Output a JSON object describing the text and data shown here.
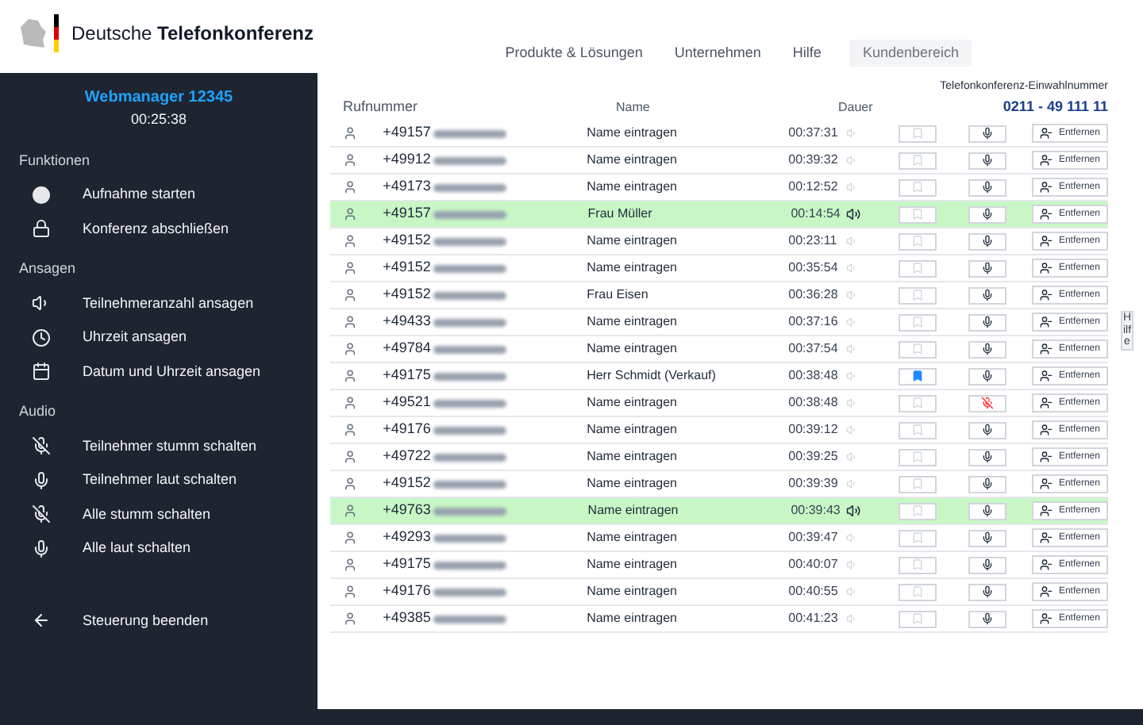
{
  "header": {
    "brand_light": "Deutsche",
    "brand_bold": "Telefonkonferenz",
    "nav": [
      {
        "label": "Produkte & Lösungen",
        "selected": false
      },
      {
        "label": "Unternehmen",
        "selected": false
      },
      {
        "label": "Hilfe",
        "selected": false
      },
      {
        "label": "Kundenbereich",
        "selected": true
      }
    ]
  },
  "sidebar": {
    "title": "Webmanager 12345",
    "timer": "00:25:38",
    "sections": [
      {
        "heading": "Funktionen",
        "items": [
          {
            "label": "Aufnahme starten",
            "kind": "record"
          },
          {
            "label": "Konferenz abschließen",
            "kind": "lock"
          }
        ]
      },
      {
        "heading": "Ansagen",
        "items": [
          {
            "label": "Teilnehmeranzahl ansagen",
            "kind": "speaker"
          },
          {
            "label": "Uhrzeit ansagen",
            "kind": "clock"
          },
          {
            "label": "Datum und Uhrzeit ansagen",
            "kind": "calendar"
          }
        ]
      },
      {
        "heading": "Audio",
        "items": [
          {
            "label": "Teilnehmer stumm schalten",
            "kind": "mute"
          },
          {
            "label": "Teilnehmer laut schalten",
            "kind": "unmute"
          },
          {
            "label": "Alle stumm schalten",
            "kind": "mute"
          },
          {
            "label": "Alle laut schalten",
            "kind": "unmute"
          }
        ]
      }
    ],
    "exit": {
      "label": "Steuerung beenden"
    }
  },
  "dial_in": {
    "label": "Telefonkonferenz-Einwahlnummer",
    "number": "0211 - 49 111 11"
  },
  "table": {
    "columns": [
      "Rufnummer",
      "Name",
      "Dauer"
    ],
    "rows": [
      {
        "number": "+49157",
        "name": "Name eintragen",
        "duration": "00:37:31",
        "speaking": false,
        "pinned": false,
        "muted": false,
        "action": "Entfernen"
      },
      {
        "number": "+49912",
        "name": "Name eintragen",
        "duration": "00:39:32",
        "speaking": false,
        "pinned": false,
        "muted": false,
        "action": "Entfernen"
      },
      {
        "number": "+49173",
        "name": "Name eintragen",
        "duration": "00:12:52",
        "speaking": false,
        "pinned": false,
        "muted": false,
        "action": "Entfernen"
      },
      {
        "number": "+49157",
        "name": "Frau Müller",
        "duration": "00:14:54",
        "speaking": true,
        "pinned": false,
        "muted": false,
        "action": "Entfernen"
      },
      {
        "number": "+49152",
        "name": "Name eintragen",
        "duration": "00:23:11",
        "speaking": false,
        "pinned": false,
        "muted": false,
        "action": "Entfernen"
      },
      {
        "number": "+49152",
        "name": "Name eintragen",
        "duration": "00:35:54",
        "speaking": false,
        "pinned": false,
        "muted": false,
        "action": "Entfernen"
      },
      {
        "number": "+49152",
        "name": "Frau Eisen",
        "duration": "00:36:28",
        "speaking": false,
        "pinned": false,
        "muted": false,
        "action": "Entfernen"
      },
      {
        "number": "+49433",
        "name": "Name eintragen",
        "duration": "00:37:16",
        "speaking": false,
        "pinned": false,
        "muted": false,
        "action": "Entfernen"
      },
      {
        "number": "+49784",
        "name": "Name eintragen",
        "duration": "00:37:54",
        "speaking": false,
        "pinned": false,
        "muted": false,
        "action": "Entfernen"
      },
      {
        "number": "+49175",
        "name": "Herr Schmidt (Verkauf)",
        "duration": "00:38:48",
        "speaking": false,
        "pinned": true,
        "muted": false,
        "action": "Entfernen"
      },
      {
        "number": "+49521",
        "name": "Name eintragen",
        "duration": "00:38:48",
        "speaking": false,
        "pinned": false,
        "muted": true,
        "action": "Entfernen"
      },
      {
        "number": "+49176",
        "name": "Name eintragen",
        "duration": "00:39:12",
        "speaking": false,
        "pinned": false,
        "muted": false,
        "action": "Entfernen"
      },
      {
        "number": "+49722",
        "name": "Name eintragen",
        "duration": "00:39:25",
        "speaking": false,
        "pinned": false,
        "muted": false,
        "action": "Entfernen"
      },
      {
        "number": "+49152",
        "name": "Name eintragen",
        "duration": "00:39:39",
        "speaking": false,
        "pinned": false,
        "muted": false,
        "action": "Entfernen"
      },
      {
        "number": "+49763",
        "name": "Name eintragen",
        "duration": "00:39:43",
        "speaking": true,
        "pinned": false,
        "muted": false,
        "action": "Entfernen"
      },
      {
        "number": "+49293",
        "name": "Name eintragen",
        "duration": "00:39:47",
        "speaking": false,
        "pinned": false,
        "muted": false,
        "action": "Entfernen"
      },
      {
        "number": "+49175",
        "name": "Name eintragen",
        "duration": "00:40:07",
        "speaking": false,
        "pinned": false,
        "muted": false,
        "action": "Entfernen"
      },
      {
        "number": "+49176",
        "name": "Name eintragen",
        "duration": "00:40:55",
        "speaking": false,
        "pinned": false,
        "muted": false,
        "action": "Entfernen"
      },
      {
        "number": "+49385",
        "name": "Name eintragen",
        "duration": "00:41:23",
        "speaking": false,
        "pinned": false,
        "muted": false,
        "action": "Entfernen"
      }
    ]
  },
  "side_tab": {
    "label": "Hilfe"
  }
}
